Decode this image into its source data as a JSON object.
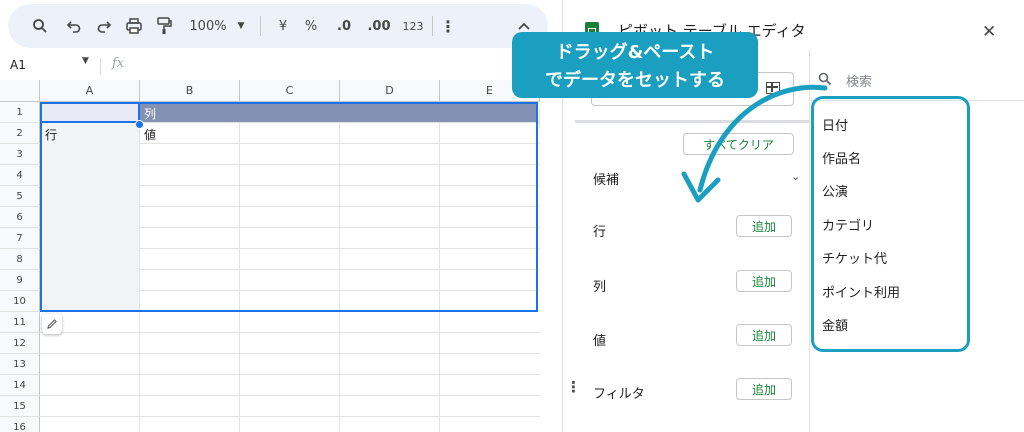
{
  "toolbar": {
    "zoom": "100%",
    "currency": "¥",
    "percent": "%",
    "decrease_decimal": ".0",
    "increase_decimal": ".00",
    "number_format": "123"
  },
  "formula_bar": {
    "cell_ref": "A1",
    "fx": "fx"
  },
  "grid": {
    "columns": [
      "A",
      "B",
      "C",
      "D",
      "E"
    ],
    "rows": [
      "1",
      "2",
      "3",
      "4",
      "5",
      "6",
      "7",
      "8",
      "9",
      "10",
      "11",
      "12",
      "13",
      "14",
      "15",
      "16"
    ],
    "cells": {
      "B1": "列",
      "A2": "行",
      "B2": "値"
    }
  },
  "callout": {
    "line1": "ドラッグ&ペースト",
    "line2": "でデータをセットする"
  },
  "panel": {
    "title": "ピボット テーブル エディタ",
    "clear_all": "すべてクリア",
    "suggestions": "候補",
    "sections": [
      {
        "label": "行",
        "add": "追加"
      },
      {
        "label": "列",
        "add": "追加"
      },
      {
        "label": "値",
        "add": "追加"
      },
      {
        "label": "フィルタ",
        "add": "追加"
      }
    ],
    "search_placeholder": "検索",
    "fields": [
      "日付",
      "作品名",
      "公演",
      "カテゴリ",
      "チケット代",
      "ポイント利用",
      "金額"
    ]
  },
  "colors": {
    "accent_teal": "#1a9fc0",
    "selection_blue": "#1a73e8",
    "header_fill": "#8391b5",
    "green_text": "#188038",
    "toolbar_bg": "#edf2fa"
  }
}
